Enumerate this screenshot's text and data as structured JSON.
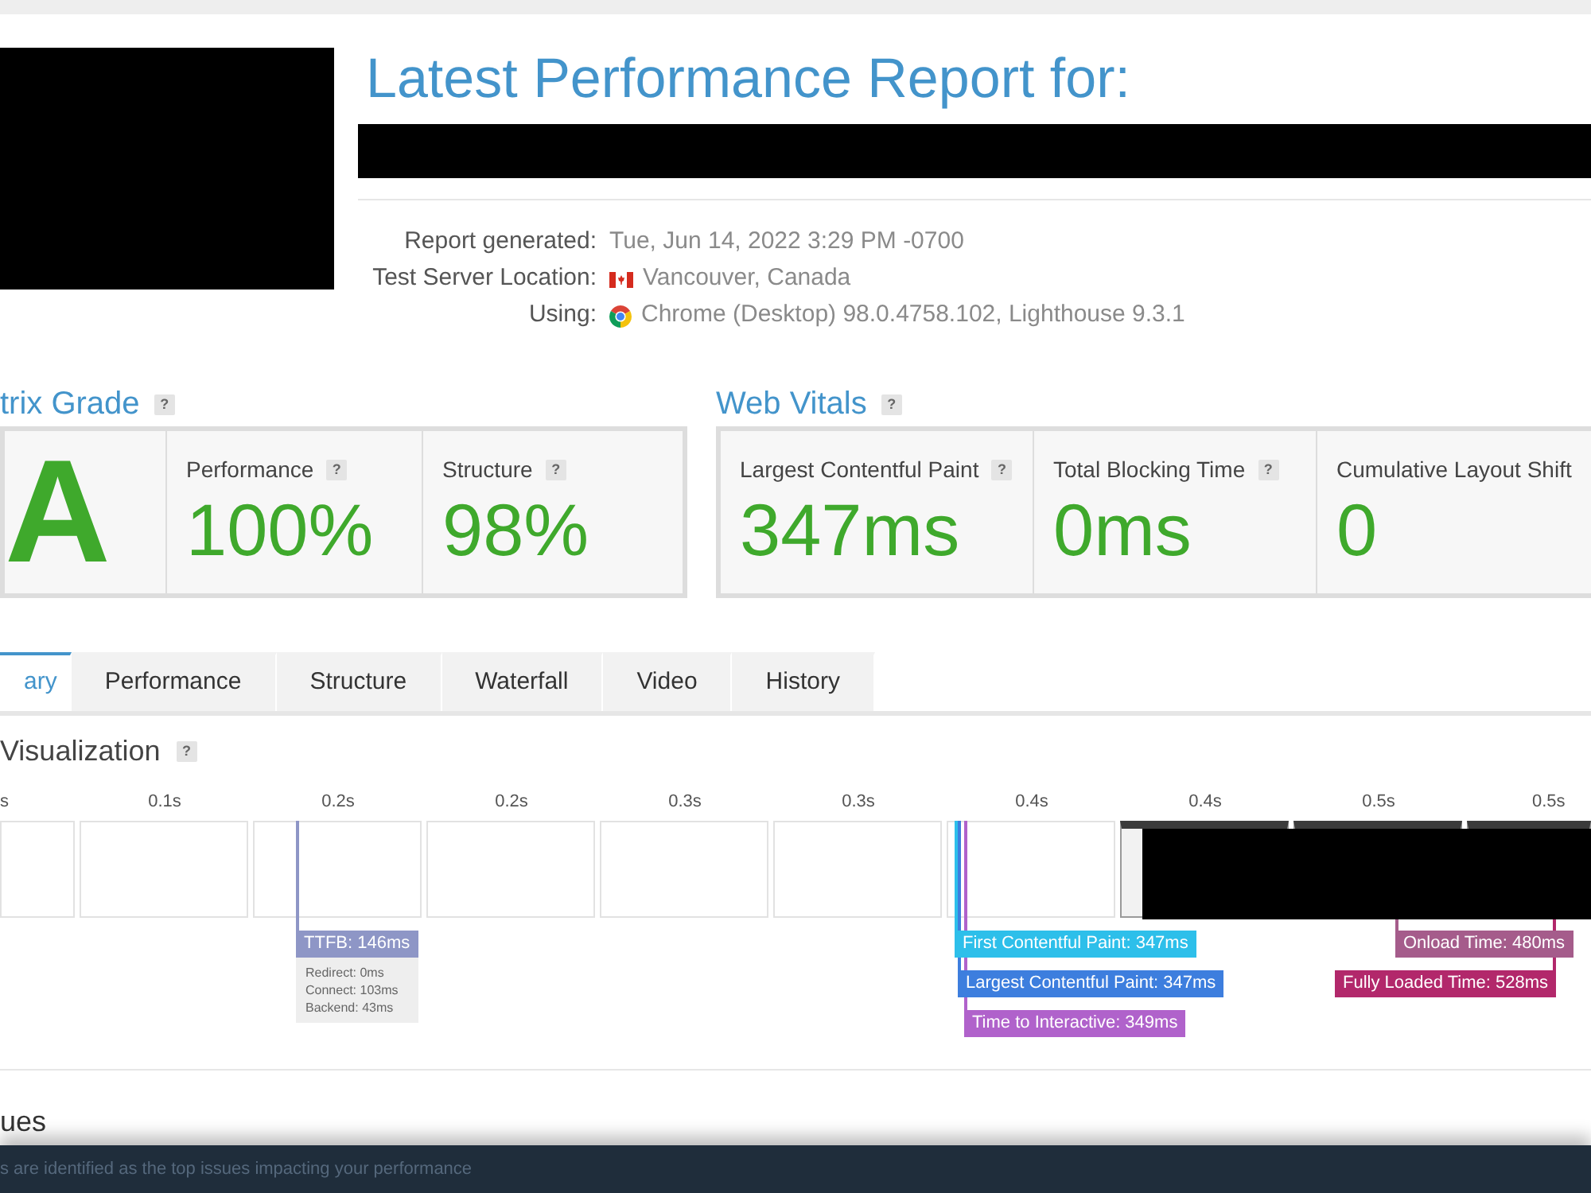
{
  "header": {
    "title": "Latest Performance Report for:",
    "details": [
      {
        "label": "Report generated:",
        "value": "Tue, Jun 14, 2022 3:29 PM -0700",
        "kind": "text"
      },
      {
        "label": "Test Server Location:",
        "value": "Vancouver, Canada",
        "kind": "flag"
      },
      {
        "label": "Using:",
        "value": "Chrome (Desktop) 98.0.4758.102, Lighthouse 9.3.1",
        "kind": "browser"
      }
    ]
  },
  "grade": {
    "title": "trix Grade",
    "help": "?",
    "letter": "A",
    "metrics": [
      {
        "label": "Performance",
        "help": "?",
        "value": "100%"
      },
      {
        "label": "Structure",
        "help": "?",
        "value": "98%"
      }
    ]
  },
  "web_vitals": {
    "title": "Web Vitals",
    "help": "?",
    "metrics": [
      {
        "label": "Largest Contentful Paint",
        "help": "?",
        "value": "347ms"
      },
      {
        "label": "Total Blocking Time",
        "help": "?",
        "value": "0ms"
      },
      {
        "label": "Cumulative Layout Shift",
        "value": "0"
      }
    ]
  },
  "tabs": [
    {
      "label": "ary",
      "selected": true
    },
    {
      "label": "Performance",
      "selected": false
    },
    {
      "label": "Structure",
      "selected": false
    },
    {
      "label": "Waterfall",
      "selected": false
    },
    {
      "label": "Video",
      "selected": false
    },
    {
      "label": "History",
      "selected": false
    }
  ],
  "timeline": {
    "title": "Visualization",
    "help": "?",
    "ticks": [
      "s",
      "0.1s",
      "0.2s",
      "0.2s",
      "0.3s",
      "0.3s",
      "0.4s",
      "0.4s",
      "0.5s",
      "0.5s"
    ],
    "frames": [
      {
        "kind": "blank"
      },
      {
        "kind": "blank"
      },
      {
        "kind": "blank"
      },
      {
        "kind": "blank"
      },
      {
        "kind": "blank"
      },
      {
        "kind": "blank"
      },
      {
        "kind": "blank"
      },
      {
        "kind": "screenshot"
      },
      {
        "kind": "screenshot"
      },
      {
        "kind": "screenshot"
      }
    ],
    "markers": [
      {
        "label": "TTFB: 146ms",
        "color": "#8e96c6",
        "details": [
          "Redirect: 0ms",
          "Connect: 103ms",
          "Backend: 43ms"
        ]
      },
      {
        "label": "First Contentful Paint: 347ms",
        "color": "#2dbfea"
      },
      {
        "label": "Largest Contentful Paint: 347ms",
        "color": "#3d7ede"
      },
      {
        "label": "Time to Interactive: 349ms",
        "color": "#b062cb"
      },
      {
        "label": "Onload Time: 480ms",
        "color": "#a55c8b"
      },
      {
        "label": "Fully Loaded Time: 528ms",
        "color": "#b2286b"
      }
    ]
  },
  "issues": {
    "title": "ues"
  },
  "notice": {
    "text": "s are identified as the top issues impacting your performance"
  }
}
